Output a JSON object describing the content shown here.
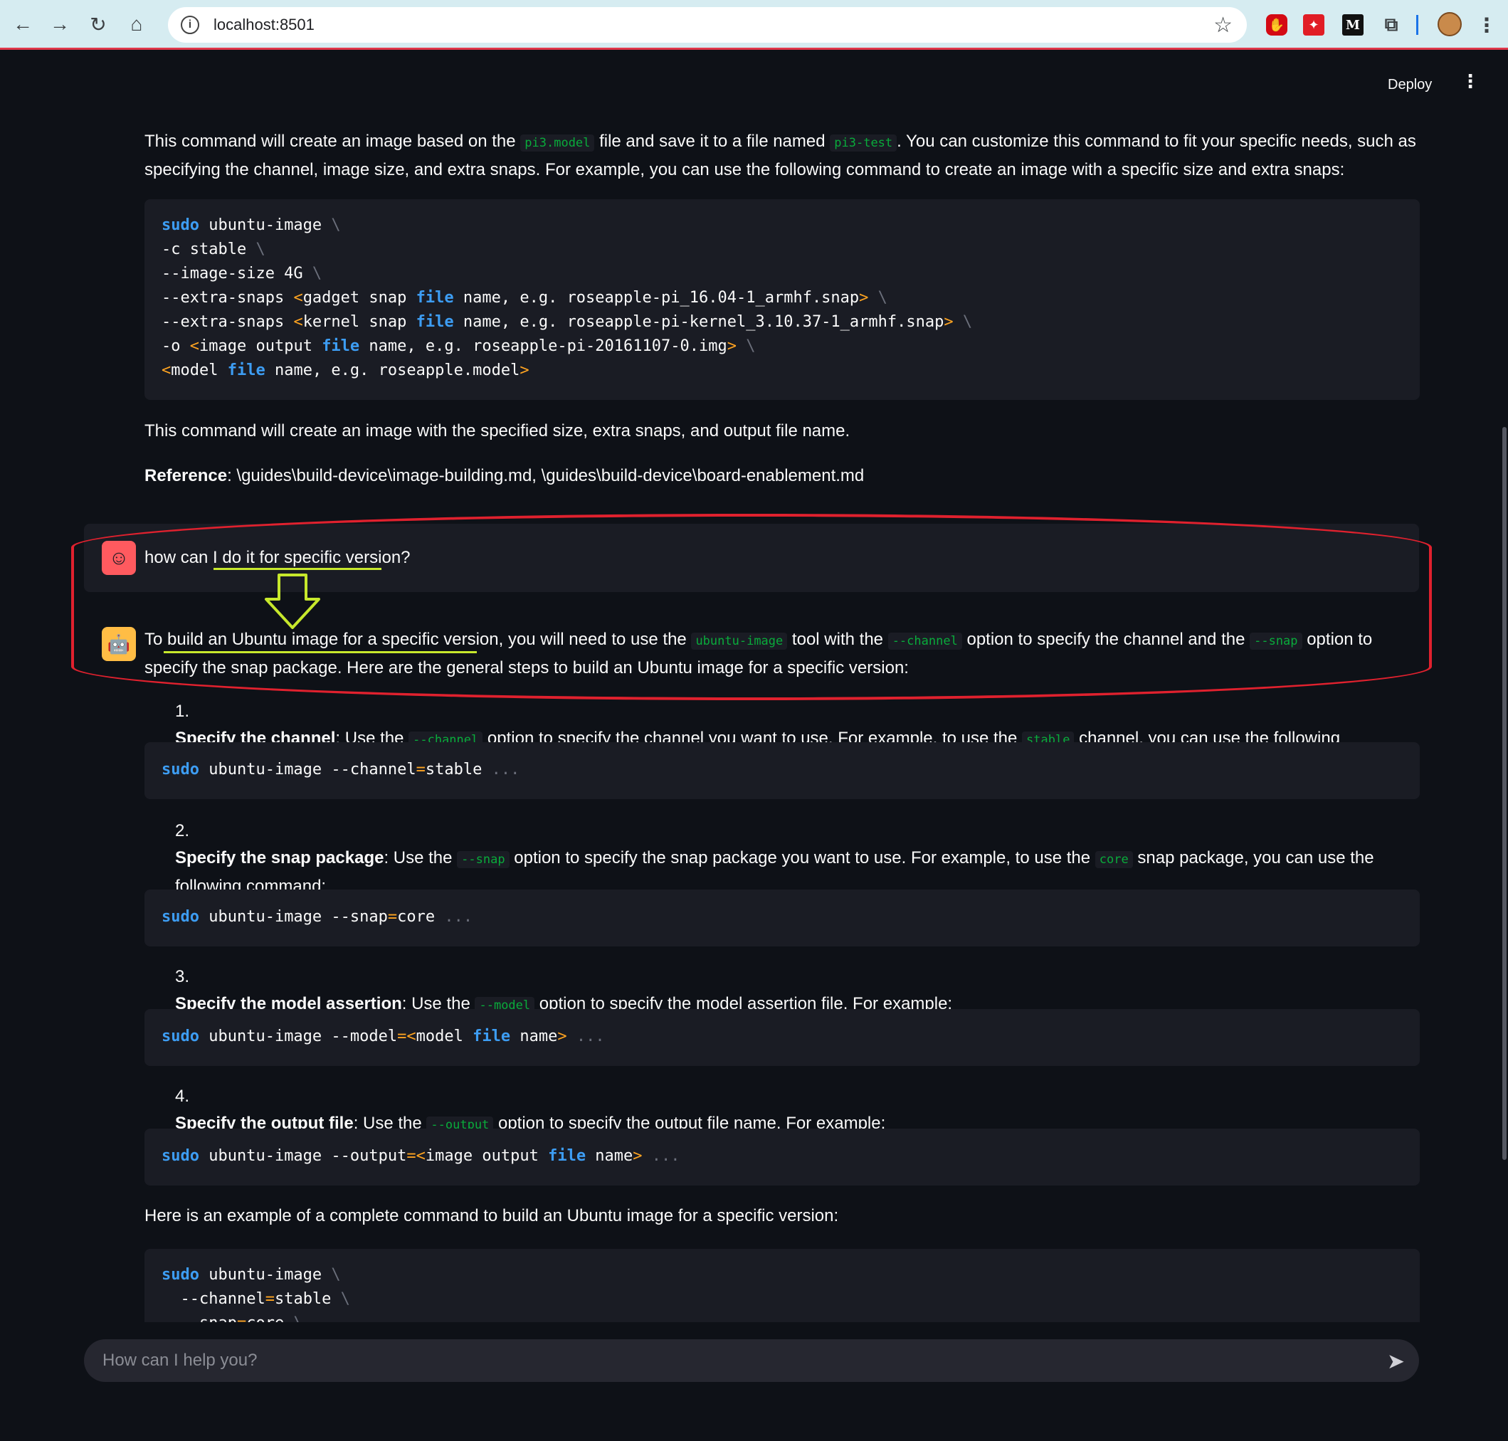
{
  "browser": {
    "url": "localhost:8501"
  },
  "header": {
    "deploy_label": "Deploy",
    "menu_icon": "⋮"
  },
  "intro": {
    "p1_a": "This command will create an image based on the ",
    "p1_code1": "pi3.model",
    "p1_b": " file and save it to a file named ",
    "p1_code2": "pi3-test",
    "p1_c": ". You can customize this command to fit your specific needs, such as specifying the channel, image size, and extra snaps. For example, you can use the following command to create an image with a specific size and extra snaps:",
    "p2": "This command will create an image with the specified size, extra snaps, and output file name.",
    "ref_label": "Reference",
    "ref_text": ": \\guides\\build-device\\image-building.md, \\guides\\build-device\\board-enablement.md"
  },
  "user_message": "how can I do it for specific version?",
  "assistant": {
    "intro_a": "To build an Ubuntu image for a specific version, you will need to use the ",
    "code_tool": "ubuntu-image",
    "intro_b": " tool with the ",
    "code_channel": "--channel",
    "intro_c": " option to specify the channel and the ",
    "code_snap": "--snap",
    "intro_d": " option to specify the snap package. Here are the general steps to build an Ubuntu image for a specific version:",
    "steps": [
      {
        "num": "1.",
        "title": "Specify the channel",
        "a": ": Use the ",
        "code": "--channel",
        "b": " option to specify the channel you want to use. For example, to use the ",
        "code2": "stable",
        "c": " channel, you can use the following command:"
      },
      {
        "num": "2.",
        "title": "Specify the snap package",
        "a": ": Use the ",
        "code": "--snap",
        "b": " option to specify the snap package you want to use. For example, to use the ",
        "code2": "core",
        "c": " snap package, you can use the following command:"
      },
      {
        "num": "3.",
        "title": "Specify the model assertion",
        "a": ": Use the ",
        "code": "--model",
        "b": " option to specify the model assertion file. For example:"
      },
      {
        "num": "4.",
        "title": "Specify the output file",
        "a": ": Use the ",
        "code": "--output",
        "b": " option to specify the output file name. For example:"
      }
    ],
    "outro": "Here is an example of a complete command to build an Ubuntu image for a specific version:"
  },
  "chat_input": {
    "placeholder": "How can I help you?"
  },
  "colors": {
    "background": "#0e1117",
    "code_bg": "#1a1c24",
    "inline_code": "#09ab3b",
    "keyword": "#3d9df3",
    "annotation_red": "#e0212e",
    "annotation_yellow": "#c7e82c"
  }
}
